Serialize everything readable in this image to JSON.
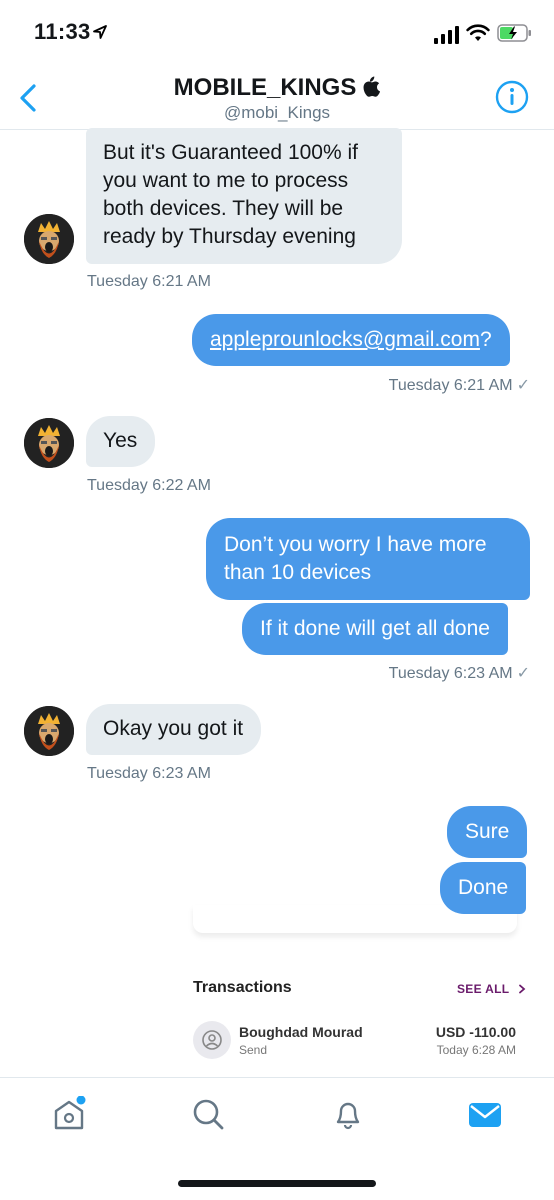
{
  "status_bar": {
    "time": "11:33"
  },
  "header": {
    "name": "MOBILE_KINGS",
    "handle": "@mobi_Kings"
  },
  "messages": [
    {
      "direction": "in",
      "text": "But it's Guaranteed 100% if you want to me to process both devices. They will be ready by Thursday evening"
    },
    {
      "direction": "in_timestamp",
      "text": "Tuesday 6:21 AM"
    },
    {
      "direction": "out",
      "text_link": "appleprounlocks@gmail.com",
      "text_suffix": "?"
    },
    {
      "direction": "out_timestamp",
      "text": "Tuesday 6:21 AM"
    },
    {
      "direction": "in",
      "text": "Yes"
    },
    {
      "direction": "in_timestamp",
      "text": "Tuesday 6:22 AM"
    },
    {
      "direction": "out",
      "text": "Don’t you worry I have more than 10 devices"
    },
    {
      "direction": "out",
      "text": "If it done will get all done"
    },
    {
      "direction": "out_timestamp",
      "text": "Tuesday 6:23 AM"
    },
    {
      "direction": "in",
      "text": "Okay you got it"
    },
    {
      "direction": "in_timestamp",
      "text": "Tuesday 6:23 AM"
    },
    {
      "direction": "out",
      "text": "Sure"
    },
    {
      "direction": "out",
      "text": "Done"
    }
  ],
  "transactions": {
    "title": "Transactions",
    "see_all": "SEE ALL",
    "item": {
      "name": "Boughdad Mourad",
      "type": "Send",
      "amount": "USD -110.00",
      "date": "Today 6:28 AM"
    }
  },
  "tabbar": {
    "tabs": [
      "home-icon",
      "search-icon",
      "notifications-icon",
      "messages-icon"
    ],
    "active": "messages-icon",
    "accent_color": "#1da1f2"
  },
  "colors": {
    "outgoing_bubble": "#4a99e9",
    "incoming_bubble": "#e6ecf0",
    "accent": "#1da1f2"
  }
}
